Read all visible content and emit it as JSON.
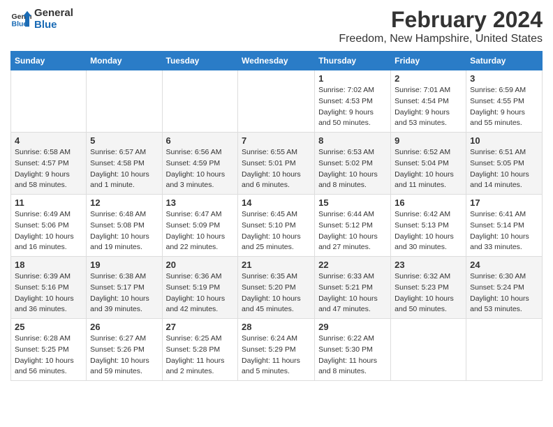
{
  "header": {
    "logo_line1": "General",
    "logo_line2": "Blue",
    "title": "February 2024",
    "subtitle": "Freedom, New Hampshire, United States"
  },
  "days_of_week": [
    "Sunday",
    "Monday",
    "Tuesday",
    "Wednesday",
    "Thursday",
    "Friday",
    "Saturday"
  ],
  "weeks": [
    [
      {
        "day": "",
        "info": ""
      },
      {
        "day": "",
        "info": ""
      },
      {
        "day": "",
        "info": ""
      },
      {
        "day": "",
        "info": ""
      },
      {
        "day": "1",
        "info": "Sunrise: 7:02 AM\nSunset: 4:53 PM\nDaylight: 9 hours\nand 50 minutes."
      },
      {
        "day": "2",
        "info": "Sunrise: 7:01 AM\nSunset: 4:54 PM\nDaylight: 9 hours\nand 53 minutes."
      },
      {
        "day": "3",
        "info": "Sunrise: 6:59 AM\nSunset: 4:55 PM\nDaylight: 9 hours\nand 55 minutes."
      }
    ],
    [
      {
        "day": "4",
        "info": "Sunrise: 6:58 AM\nSunset: 4:57 PM\nDaylight: 9 hours\nand 58 minutes."
      },
      {
        "day": "5",
        "info": "Sunrise: 6:57 AM\nSunset: 4:58 PM\nDaylight: 10 hours\nand 1 minute."
      },
      {
        "day": "6",
        "info": "Sunrise: 6:56 AM\nSunset: 4:59 PM\nDaylight: 10 hours\nand 3 minutes."
      },
      {
        "day": "7",
        "info": "Sunrise: 6:55 AM\nSunset: 5:01 PM\nDaylight: 10 hours\nand 6 minutes."
      },
      {
        "day": "8",
        "info": "Sunrise: 6:53 AM\nSunset: 5:02 PM\nDaylight: 10 hours\nand 8 minutes."
      },
      {
        "day": "9",
        "info": "Sunrise: 6:52 AM\nSunset: 5:04 PM\nDaylight: 10 hours\nand 11 minutes."
      },
      {
        "day": "10",
        "info": "Sunrise: 6:51 AM\nSunset: 5:05 PM\nDaylight: 10 hours\nand 14 minutes."
      }
    ],
    [
      {
        "day": "11",
        "info": "Sunrise: 6:49 AM\nSunset: 5:06 PM\nDaylight: 10 hours\nand 16 minutes."
      },
      {
        "day": "12",
        "info": "Sunrise: 6:48 AM\nSunset: 5:08 PM\nDaylight: 10 hours\nand 19 minutes."
      },
      {
        "day": "13",
        "info": "Sunrise: 6:47 AM\nSunset: 5:09 PM\nDaylight: 10 hours\nand 22 minutes."
      },
      {
        "day": "14",
        "info": "Sunrise: 6:45 AM\nSunset: 5:10 PM\nDaylight: 10 hours\nand 25 minutes."
      },
      {
        "day": "15",
        "info": "Sunrise: 6:44 AM\nSunset: 5:12 PM\nDaylight: 10 hours\nand 27 minutes."
      },
      {
        "day": "16",
        "info": "Sunrise: 6:42 AM\nSunset: 5:13 PM\nDaylight: 10 hours\nand 30 minutes."
      },
      {
        "day": "17",
        "info": "Sunrise: 6:41 AM\nSunset: 5:14 PM\nDaylight: 10 hours\nand 33 minutes."
      }
    ],
    [
      {
        "day": "18",
        "info": "Sunrise: 6:39 AM\nSunset: 5:16 PM\nDaylight: 10 hours\nand 36 minutes."
      },
      {
        "day": "19",
        "info": "Sunrise: 6:38 AM\nSunset: 5:17 PM\nDaylight: 10 hours\nand 39 minutes."
      },
      {
        "day": "20",
        "info": "Sunrise: 6:36 AM\nSunset: 5:19 PM\nDaylight: 10 hours\nand 42 minutes."
      },
      {
        "day": "21",
        "info": "Sunrise: 6:35 AM\nSunset: 5:20 PM\nDaylight: 10 hours\nand 45 minutes."
      },
      {
        "day": "22",
        "info": "Sunrise: 6:33 AM\nSunset: 5:21 PM\nDaylight: 10 hours\nand 47 minutes."
      },
      {
        "day": "23",
        "info": "Sunrise: 6:32 AM\nSunset: 5:23 PM\nDaylight: 10 hours\nand 50 minutes."
      },
      {
        "day": "24",
        "info": "Sunrise: 6:30 AM\nSunset: 5:24 PM\nDaylight: 10 hours\nand 53 minutes."
      }
    ],
    [
      {
        "day": "25",
        "info": "Sunrise: 6:28 AM\nSunset: 5:25 PM\nDaylight: 10 hours\nand 56 minutes."
      },
      {
        "day": "26",
        "info": "Sunrise: 6:27 AM\nSunset: 5:26 PM\nDaylight: 10 hours\nand 59 minutes."
      },
      {
        "day": "27",
        "info": "Sunrise: 6:25 AM\nSunset: 5:28 PM\nDaylight: 11 hours\nand 2 minutes."
      },
      {
        "day": "28",
        "info": "Sunrise: 6:24 AM\nSunset: 5:29 PM\nDaylight: 11 hours\nand 5 minutes."
      },
      {
        "day": "29",
        "info": "Sunrise: 6:22 AM\nSunset: 5:30 PM\nDaylight: 11 hours\nand 8 minutes."
      },
      {
        "day": "",
        "info": ""
      },
      {
        "day": "",
        "info": ""
      }
    ]
  ]
}
